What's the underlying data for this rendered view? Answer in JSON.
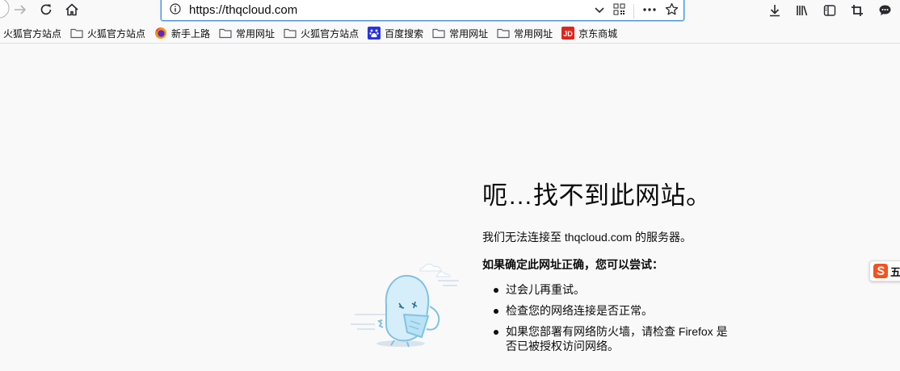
{
  "urlbar": {
    "url": "https://thqcloud.com"
  },
  "bookmarks": [
    {
      "label": "火狐官方站点",
      "icon": "none"
    },
    {
      "label": "火狐官方站点",
      "icon": "folder-icon"
    },
    {
      "label": "新手上路",
      "icon": "firefox-icon"
    },
    {
      "label": "常用网址",
      "icon": "folder-icon"
    },
    {
      "label": "火狐官方站点",
      "icon": "folder-icon"
    },
    {
      "label": "百度搜索",
      "icon": "baidu-icon"
    },
    {
      "label": "常用网址",
      "icon": "folder-icon"
    },
    {
      "label": "常用网址",
      "icon": "folder-icon"
    },
    {
      "label": "京东商城",
      "icon": "jd-icon"
    }
  ],
  "error": {
    "title": "呃…找不到此网站。",
    "description": "我们无法连接至 thqcloud.com 的服务器。",
    "suggest_heading": "如果确定此网址正确，您可以尝试：",
    "tips": [
      "过会儿再重试。",
      "检查您的网络连接是否正常。",
      "如果您部署有网络防火墙，请检查 Firefox 是否已被授权访问网络。"
    ]
  },
  "side_widget": {
    "label": "五"
  },
  "colors": {
    "page_bg": "#f9f9fa",
    "focus_ring": "#4a90d9",
    "sogou_orange": "#f4511e",
    "jd_red": "#e1251b",
    "baidu_blue": "#2932e1"
  }
}
